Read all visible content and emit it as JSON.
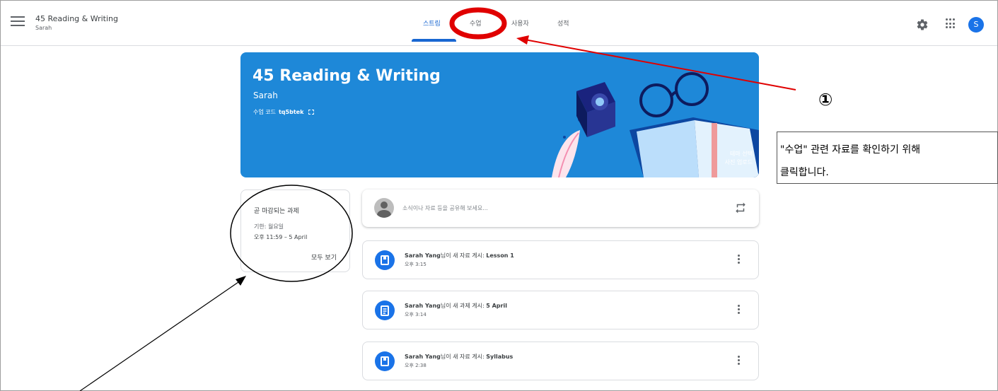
{
  "header": {
    "class_title": "45 Reading & Writing",
    "class_subtitle": "Sarah",
    "tabs": [
      {
        "label": "스트림",
        "active": true
      },
      {
        "label": "수업",
        "active": false
      },
      {
        "label": "사용자",
        "active": false
      },
      {
        "label": "성적",
        "active": false
      }
    ],
    "avatar_initial": "S",
    "icons": {
      "menu": "hamburger-menu-icon",
      "settings": "gear-icon",
      "apps": "apps-grid-icon"
    }
  },
  "banner": {
    "title": "45 Reading & Writing",
    "teacher": "Sarah",
    "code_label": "수업 코드",
    "code_value": "tq5btek",
    "theme_link": "테마 선택",
    "upload_link": "사진 업로드",
    "background_color": "#1e88d8"
  },
  "upcoming": {
    "title": "곧 마감되는 과제",
    "due_label": "기한: 월요일",
    "due_time": "오후 11:59 – 5 April",
    "view_all": "모두 보기"
  },
  "share": {
    "placeholder": "소식이나 자료 등을 공유해 보세요..."
  },
  "posts": [
    {
      "author": "Sarah Yang",
      "action": "님이 새 자료 게시: ",
      "item": "Lesson 1",
      "time": "오후 3:15",
      "icon": "material-icon"
    },
    {
      "author": "Sarah Yang",
      "action": "님이 새 과제 게시: ",
      "item": "5 April",
      "time": "오후 3:14",
      "icon": "assignment-icon"
    },
    {
      "author": "Sarah Yang",
      "action": "님이 새 자료 게시: ",
      "item": "Syllabus",
      "time": "오후 2:38",
      "icon": "material-icon"
    }
  ],
  "annotation": {
    "step_marker": "①",
    "callout_line1": "\"수업\" 관련 자료를 확인하기 위해",
    "callout_line2": "클릭합니다.",
    "highlight_color": "#e00000"
  },
  "colors": {
    "accent": "#1967d2",
    "post_icon": "#1a73e8"
  }
}
